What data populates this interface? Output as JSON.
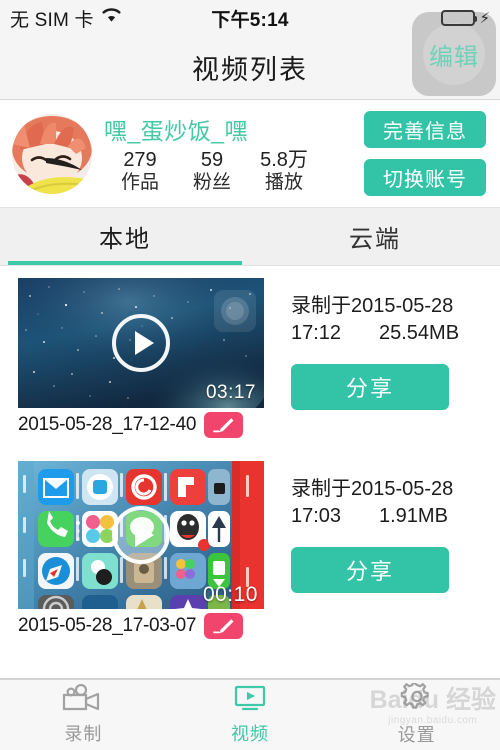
{
  "status_bar": {
    "carrier": "无 SIM 卡",
    "wifi_icon": "wifi-icon",
    "time": "下午5:14",
    "battery_icon": "battery-full-icon",
    "charging_icon": "lightning-bolt-icon"
  },
  "nav": {
    "title": "视频列表",
    "edit_label": "编辑"
  },
  "profile": {
    "avatar_alt": "user-avatar",
    "username": "嘿_蛋炒饭_嘿",
    "stats": [
      {
        "value": "279",
        "label": "作品"
      },
      {
        "value": "59",
        "label": "粉丝"
      },
      {
        "value": "5.8万",
        "label": "播放"
      }
    ],
    "actions": [
      {
        "label": "完善信息",
        "name": "complete-profile-button"
      },
      {
        "label": "切换账号",
        "name": "switch-account-button"
      }
    ]
  },
  "tabs": {
    "items": [
      {
        "label": "本地",
        "active": true
      },
      {
        "label": "云端",
        "active": false
      }
    ]
  },
  "videos": [
    {
      "thumbnail": "starry-night-wallpaper",
      "duration": "03:17",
      "filename": "2015-05-28_17-12-40",
      "rename_icon": "pencil-icon",
      "recorded_prefix": "录制于2015-05-28",
      "recorded_time": "17:12",
      "size": "25.54MB",
      "share_label": "分享"
    },
    {
      "thumbnail": "ios-homescreen-landscape",
      "duration": "00:10",
      "filename": "2015-05-28_17-03-07",
      "rename_icon": "pencil-icon",
      "recorded_prefix": "录制于2015-05-28",
      "recorded_time": "17:03",
      "size": "1.91MB",
      "share_label": "分享"
    }
  ],
  "tabbar": {
    "items": [
      {
        "label": "录制",
        "icon": "video-camera-icon",
        "active": false
      },
      {
        "label": "视频",
        "icon": "monitor-play-icon",
        "active": true
      },
      {
        "label": "设置",
        "icon": "gear-icon",
        "active": false
      }
    ]
  },
  "watermark": {
    "main": "Baidu 经验",
    "sub": "jingyan.baidu.com"
  },
  "colors": {
    "accent": "#33c4a8",
    "accent_light": "#3ec9a7",
    "rename_badge": "#f2456e",
    "bar_bg": "#f5f5f5",
    "tab_bg": "#f0f0f0"
  }
}
